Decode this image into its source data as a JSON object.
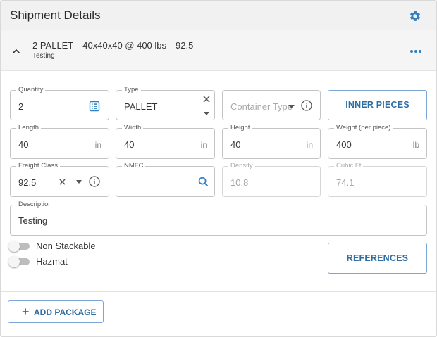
{
  "header": {
    "title": "Shipment Details",
    "settings_icon": "gear-icon"
  },
  "summary": {
    "quantity_type": "2 PALLET",
    "dims_weight": "40x40x40 @ 400 lbs",
    "freight_class": "92.5",
    "description": "Testing"
  },
  "fields": {
    "quantity": {
      "label": "Quantity",
      "value": "2"
    },
    "type": {
      "label": "Type",
      "value": "PALLET"
    },
    "container_type": {
      "placeholder": "Container Type"
    },
    "length": {
      "label": "Length",
      "value": "40",
      "unit": "in"
    },
    "width": {
      "label": "Width",
      "value": "40",
      "unit": "in"
    },
    "height": {
      "label": "Height",
      "value": "40",
      "unit": "in"
    },
    "weight": {
      "label": "Weight (per piece)",
      "value": "400",
      "unit": "lb"
    },
    "freight_class": {
      "label": "Freight Class",
      "value": "92.5"
    },
    "nmfc": {
      "label": "NMFC",
      "value": ""
    },
    "density": {
      "label": "Density",
      "value": "10.8"
    },
    "cubic_ft": {
      "label": "Cubic Ft",
      "value": "74.1"
    },
    "description": {
      "label": "Description",
      "value": "Testing"
    }
  },
  "buttons": {
    "inner_pieces": "INNER PIECES",
    "references": "REFERENCES",
    "add_package": "ADD PACKAGE"
  },
  "toggles": {
    "non_stackable": {
      "label": "Non Stackable",
      "on": false
    },
    "hazmat": {
      "label": "Hazmat",
      "on": false
    }
  },
  "colors": {
    "accent": "#2f7fc1",
    "header_bg": "#f1f1f2",
    "border": "#c4c4c4"
  }
}
